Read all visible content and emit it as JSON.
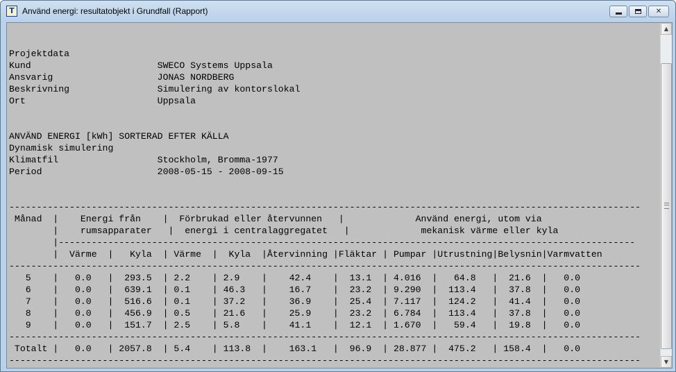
{
  "window": {
    "title": "Använd energi: resultatobjekt i Grundfall (Rapport)",
    "app_icon": "app-icon",
    "controls": {
      "minimize": "minimize-icon",
      "maximize": "maximize-icon",
      "close": "close-icon"
    }
  },
  "report": {
    "lines": [
      "",
      "",
      "Projektdata",
      "Kund                       SWECO Systems Uppsala",
      "Ansvarig                   JONAS NORDBERG",
      "Beskrivning                Simulering av kontorslokal",
      "Ort                        Uppsala",
      "",
      "",
      "ANVÄND ENERGI [kWh] SORTERAD EFTER KÄLLA",
      "Dynamisk simulering",
      "Klimatfil                  Stockholm, Bromma-1977",
      "Period                     2008-05-15 - 2008-09-15",
      "",
      "",
      "-------------------------------------------------------------------------------------------------------------------",
      " Månad  |    Energi från    |  Förbrukad eller återvunnen   |             Använd energi, utom via",
      "        |    rumsapparater   |  energi i centralaggregatet   |             mekanisk värme eller kyla",
      "        |---------------------------------------------------------------------------------------------------------",
      "        |  Värme  |   Kyla  | Värme  |  Kyla  |Återvinning |Fläktar | Pumpar |Utrustning|Belysnin|Varmvatten",
      "-------------------------------------------------------------------------------------------------------------------",
      "   5    |   0.0   |  293.5  | 2.2    | 2.9    |    42.4    |  13.1  | 4.016  |   64.8   |  21.6  |   0.0",
      "   6    |   0.0   |  639.1  | 0.1    | 46.3   |    16.7    |  23.2  | 9.290  |  113.4   |  37.8  |   0.0",
      "   7    |   0.0   |  516.6  | 0.1    | 37.2   |    36.9    |  25.4  | 7.117  |  124.2   |  41.4  |   0.0",
      "   8    |   0.0   |  456.9  | 0.5    | 21.6   |    25.9    |  23.2  | 6.784  |  113.4   |  37.8  |   0.0",
      "   9    |   0.0   |  151.7  | 2.5    | 5.8    |    41.1    |  12.1  | 1.670  |   59.4   |  19.8  |   0.0",
      "-------------------------------------------------------------------------------------------------------------------",
      " Totalt |   0.0   | 2057.8  | 5.4    | 113.8  |    163.1   |  96.9  | 28.877 |  475.2   | 158.4  |   0.0",
      "-------------------------------------------------------------------------------------------------------------------"
    ]
  },
  "scrollbar": {
    "up_icon": "scroll-up-arrow-icon",
    "down_icon": "scroll-down-arrow-icon"
  }
}
